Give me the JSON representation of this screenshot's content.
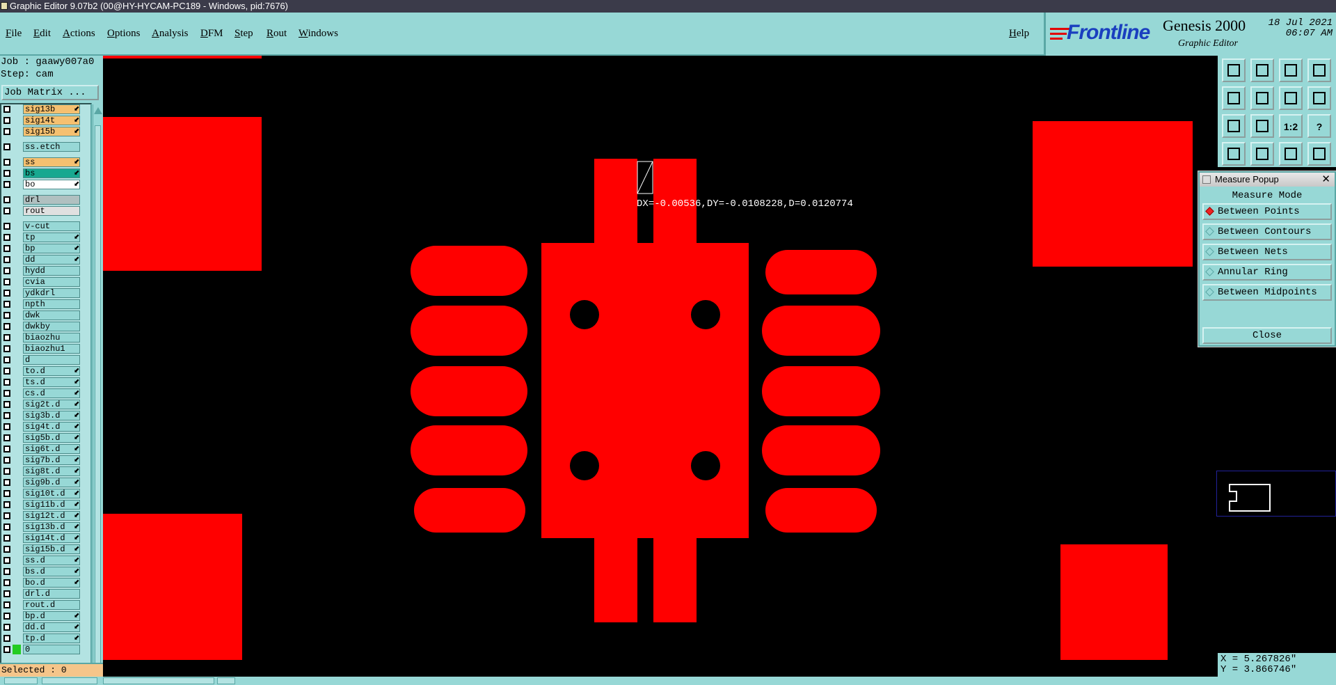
{
  "window": {
    "title": "Graphic Editor 9.07b2 (00@HY-HYCAM-PC189 - Windows, pid:7676)"
  },
  "menu": {
    "items": [
      "File",
      "Edit",
      "Actions",
      "Options",
      "Analysis",
      "DFM",
      "Step",
      "Rout",
      "Windows"
    ],
    "help": "Help"
  },
  "brand": {
    "logo": "Frontline",
    "product": "Genesis 2000",
    "subtitle": "Graphic Editor",
    "date": "18 Jul 2021",
    "time": "06:07 AM"
  },
  "job": {
    "job_line": "Job : gaawy007a0",
    "step_line": "Step: cam",
    "matrix_button": "Job Matrix ..."
  },
  "layers": [
    {
      "name": "sig13b",
      "color": "#f5c070",
      "mark": true
    },
    {
      "name": "sig14t",
      "color": "#f5c070",
      "mark": true
    },
    {
      "name": "sig15b",
      "color": "#f5c070",
      "mark": true
    },
    {
      "name": "ss.etch",
      "color": "#97d8d6",
      "mark": false
    },
    {
      "name": "ss",
      "color": "#f5c070",
      "mark": true
    },
    {
      "name": "bs",
      "color": "#18a890",
      "mark": true
    },
    {
      "name": "bo",
      "color": "#ffffff",
      "mark": true
    },
    {
      "name": "drl",
      "color": "#b0c0c0",
      "mark": false
    },
    {
      "name": "rout",
      "color": "#e0e0e0",
      "mark": false
    },
    {
      "name": "v-cut",
      "color": "#97d8d6",
      "mark": false
    },
    {
      "name": "tp",
      "color": "#97d8d6",
      "mark": true
    },
    {
      "name": "bp",
      "color": "#97d8d6",
      "mark": true
    },
    {
      "name": "dd",
      "color": "#97d8d6",
      "mark": true
    },
    {
      "name": "hydd",
      "color": "#97d8d6",
      "mark": false
    },
    {
      "name": "cvia",
      "color": "#97d8d6",
      "mark": false
    },
    {
      "name": "ydkdrl",
      "color": "#97d8d6",
      "mark": false
    },
    {
      "name": "npth",
      "color": "#97d8d6",
      "mark": false
    },
    {
      "name": "dwk",
      "color": "#97d8d6",
      "mark": false
    },
    {
      "name": "dwkby",
      "color": "#97d8d6",
      "mark": false
    },
    {
      "name": "biaozhu",
      "color": "#97d8d6",
      "mark": false
    },
    {
      "name": "biaozhu1",
      "color": "#97d8d6",
      "mark": false
    },
    {
      "name": "d",
      "color": "#97d8d6",
      "mark": false
    },
    {
      "name": "to.d",
      "color": "#97d8d6",
      "mark": true
    },
    {
      "name": "ts.d",
      "color": "#97d8d6",
      "mark": true
    },
    {
      "name": "cs.d",
      "color": "#97d8d6",
      "mark": true
    },
    {
      "name": "sig2t.d",
      "color": "#97d8d6",
      "mark": true
    },
    {
      "name": "sig3b.d",
      "color": "#97d8d6",
      "mark": true
    },
    {
      "name": "sig4t.d",
      "color": "#97d8d6",
      "mark": true
    },
    {
      "name": "sig5b.d",
      "color": "#97d8d6",
      "mark": true
    },
    {
      "name": "sig6t.d",
      "color": "#97d8d6",
      "mark": true
    },
    {
      "name": "sig7b.d",
      "color": "#97d8d6",
      "mark": true
    },
    {
      "name": "sig8t.d",
      "color": "#97d8d6",
      "mark": true
    },
    {
      "name": "sig9b.d",
      "color": "#97d8d6",
      "mark": true
    },
    {
      "name": "sig10t.d",
      "color": "#97d8d6",
      "mark": true
    },
    {
      "name": "sig11b.d",
      "color": "#97d8d6",
      "mark": true
    },
    {
      "name": "sig12t.d",
      "color": "#97d8d6",
      "mark": true
    },
    {
      "name": "sig13b.d",
      "color": "#97d8d6",
      "mark": true
    },
    {
      "name": "sig14t.d",
      "color": "#97d8d6",
      "mark": true
    },
    {
      "name": "sig15b.d",
      "color": "#97d8d6",
      "mark": true
    },
    {
      "name": "ss.d",
      "color": "#97d8d6",
      "mark": true
    },
    {
      "name": "bs.d",
      "color": "#97d8d6",
      "mark": true
    },
    {
      "name": "bo.d",
      "color": "#97d8d6",
      "mark": true
    },
    {
      "name": "drl.d",
      "color": "#97d8d6",
      "mark": false
    },
    {
      "name": "rout.d",
      "color": "#97d8d6",
      "mark": false
    },
    {
      "name": "bp.d",
      "color": "#97d8d6",
      "mark": true
    },
    {
      "name": "dd.d",
      "color": "#97d8d6",
      "mark": true
    },
    {
      "name": "tp.d",
      "color": "#97d8d6",
      "mark": true
    },
    {
      "name": "0",
      "color": "#97d8d6",
      "mark": false
    }
  ],
  "layer_mark_glyph": "⬋",
  "status": {
    "selected": "Selected : 0"
  },
  "canvas": {
    "measure_readout": "DX=-0.00536,DY=-0.0108228,D=0.0120774",
    "feature_color": "#ff0000"
  },
  "toolbar": {
    "tools": [
      {
        "name": "tool-1",
        "icon": "window-top-icon"
      },
      {
        "name": "tool-2",
        "icon": "window-bottom-icon"
      },
      {
        "name": "tool-3",
        "icon": "home-icon"
      },
      {
        "name": "tool-4",
        "icon": "split-view-icon"
      },
      {
        "name": "tool-5",
        "icon": "pan-left-icon"
      },
      {
        "name": "tool-6",
        "icon": "pan-right-icon"
      },
      {
        "name": "tool-7",
        "icon": "undo-icon"
      },
      {
        "name": "tool-8",
        "icon": "redo-icon"
      },
      {
        "name": "tool-9",
        "icon": "zoom-in-icon"
      },
      {
        "name": "tool-10",
        "icon": "zoom-out-icon"
      },
      {
        "name": "tool-11",
        "icon": "ratio-icon",
        "label": "1:2"
      },
      {
        "name": "tool-12",
        "icon": "help-icon",
        "label": "?"
      },
      {
        "name": "tool-13",
        "icon": "pencil-icon"
      },
      {
        "name": "tool-14",
        "icon": "measure-icon"
      },
      {
        "name": "tool-15",
        "icon": "net-icon"
      },
      {
        "name": "tool-16",
        "icon": "net-select-icon"
      }
    ]
  },
  "measure_popup": {
    "title": "Measure Popup",
    "mode_heading": "Measure Mode",
    "options": [
      "Between Points",
      "Between Contours",
      "Between Nets",
      "Annular Ring",
      "Between Midpoints"
    ],
    "selected_index": 0,
    "close_label": "Close"
  },
  "coordinates": {
    "x": "X = 5.267826\"",
    "y": "Y = 3.866746\""
  }
}
